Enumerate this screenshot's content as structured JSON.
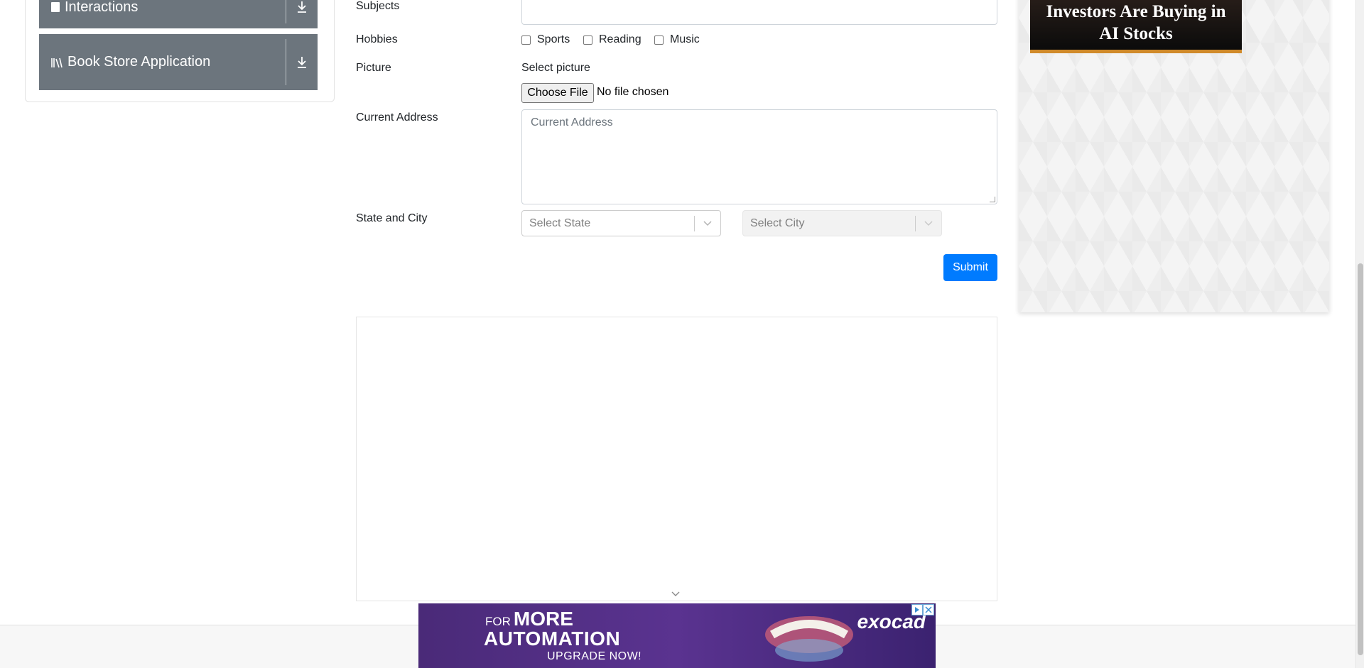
{
  "sidebar": {
    "groups": [
      {
        "label": "Interactions",
        "icon": "interactions-icon"
      },
      {
        "label": "Book Store Application",
        "icon": "books-icon"
      }
    ]
  },
  "form": {
    "subjects_label": "Subjects",
    "hobbies_label": "Hobbies",
    "hobbies": [
      "Sports",
      "Reading",
      "Music"
    ],
    "picture_label": "Picture",
    "select_picture": "Select picture",
    "choose_file": "Choose File",
    "no_file": "No file chosen",
    "address_label": "Current Address",
    "address_placeholder": "Current Address",
    "state_city_label": "State and City",
    "state_placeholder": "Select State",
    "city_placeholder": "Select City",
    "submit": "Submit"
  },
  "right_ad": {
    "headline_line1": "Investors Are Buying in",
    "headline_line2": "AI Stocks"
  },
  "bottom_ad": {
    "for": "FOR",
    "more": "MORE",
    "automation": "AUTOMATION",
    "cta": "UPGRADE NOW!",
    "brand": "exocad"
  },
  "colors": {
    "sidebar_bg": "#6c757d",
    "primary": "#007bff",
    "banner_bg": "#4a2a78",
    "ad_accent": "#d08a2a"
  }
}
